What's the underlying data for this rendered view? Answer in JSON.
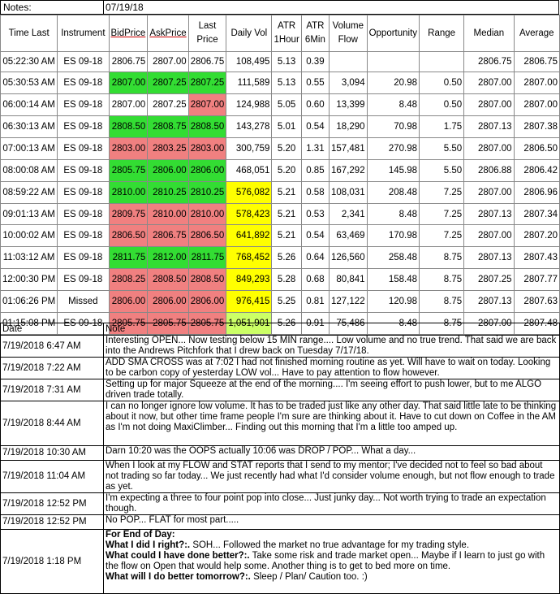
{
  "notes_bar": {
    "label": "Notes:",
    "date": "07/19/18"
  },
  "columns": [
    "Time Last",
    "Instrument",
    "BidPrice",
    "AskPrice",
    "Last Price",
    "Daily Vol",
    "ATR 1Hour",
    "ATR 6Min",
    "Volume Flow",
    "Opportunity",
    "Range",
    "Median",
    "Average"
  ],
  "colors": {
    "red": "#f08080",
    "green": "#33dd33",
    "yellow": "#ffff00",
    "light_green": "#ccff66"
  },
  "rows": [
    {
      "cells": [
        "05:22:30 AM",
        "ES 09-18",
        "2806.75",
        "2807.00",
        "2806.75",
        "108,495",
        "5.13",
        "0.39",
        "",
        "",
        "",
        "2806.75",
        "2806.75"
      ],
      "bid": "",
      "ask": "",
      "last": "",
      "vol": ""
    },
    {
      "cells": [
        "05:30:53 AM",
        "ES 09-18",
        "2807.00",
        "2807.25",
        "2807.25",
        "111,589",
        "5.13",
        "0.55",
        "3,094",
        "20.98",
        "0.50",
        "2807.00",
        "2807.00"
      ],
      "bid": "green",
      "ask": "green",
      "last": "green",
      "vol": ""
    },
    {
      "cells": [
        "06:00:14 AM",
        "ES 09-18",
        "2807.00",
        "2807.25",
        "2807.00",
        "124,988",
        "5.05",
        "0.60",
        "13,399",
        "8.48",
        "0.50",
        "2807.00",
        "2807.00"
      ],
      "bid": "",
      "ask": "",
      "last": "red",
      "vol": ""
    },
    {
      "cells": [
        "06:30:13 AM",
        "ES 09-18",
        "2808.50",
        "2808.75",
        "2808.50",
        "143,278",
        "5.01",
        "0.54",
        "18,290",
        "70.98",
        "1.75",
        "2807.13",
        "2807.38"
      ],
      "bid": "green",
      "ask": "green",
      "last": "green",
      "vol": ""
    },
    {
      "cells": [
        "07:00:13 AM",
        "ES 09-18",
        "2803.00",
        "2803.25",
        "2803.00",
        "300,759",
        "5.20",
        "1.31",
        "157,481",
        "270.98",
        "5.50",
        "2807.00",
        "2806.50"
      ],
      "bid": "red",
      "ask": "red",
      "last": "red",
      "vol": ""
    },
    {
      "cells": [
        "08:00:08 AM",
        "ES 09-18",
        "2805.75",
        "2806.00",
        "2806.00",
        "468,051",
        "5.20",
        "0.85",
        "167,292",
        "145.98",
        "5.50",
        "2806.88",
        "2806.42"
      ],
      "bid": "green",
      "ask": "green",
      "last": "green",
      "vol": ""
    },
    {
      "cells": [
        "08:59:22 AM",
        "ES 09-18",
        "2810.00",
        "2810.25",
        "2810.25",
        "576,082",
        "5.21",
        "0.58",
        "108,031",
        "208.48",
        "7.25",
        "2807.00",
        "2806.96"
      ],
      "bid": "green",
      "ask": "green",
      "last": "green",
      "vol": "yellow"
    },
    {
      "cells": [
        "09:01:13 AM",
        "ES 09-18",
        "2809.75",
        "2810.00",
        "2810.00",
        "578,423",
        "5.21",
        "0.53",
        "2,341",
        "8.48",
        "7.25",
        "2807.13",
        "2807.34"
      ],
      "bid": "red",
      "ask": "red",
      "last": "red",
      "vol": "yellow"
    },
    {
      "cells": [
        "10:00:02 AM",
        "ES 09-18",
        "2806.50",
        "2806.75",
        "2806.50",
        "641,892",
        "5.21",
        "0.54",
        "63,469",
        "170.98",
        "7.25",
        "2807.00",
        "2807.20"
      ],
      "bid": "red",
      "ask": "red",
      "last": "red",
      "vol": "yellow"
    },
    {
      "cells": [
        "11:03:12 AM",
        "ES 09-18",
        "2811.75",
        "2812.00",
        "2811.75",
        "768,452",
        "5.26",
        "0.64",
        "126,560",
        "258.48",
        "8.75",
        "2807.13",
        "2807.43"
      ],
      "bid": "green",
      "ask": "green",
      "last": "green",
      "vol": "yellow"
    },
    {
      "cells": [
        "12:00:30 PM",
        "ES 09-18",
        "2808.25",
        "2808.50",
        "2808.50",
        "849,293",
        "5.28",
        "0.68",
        "80,841",
        "158.48",
        "8.75",
        "2807.25",
        "2807.77"
      ],
      "bid": "red",
      "ask": "red",
      "last": "red",
      "vol": "yellow"
    },
    {
      "cells": [
        "01:06:26 PM",
        "Missed",
        "2806.00",
        "2806.00",
        "2806.00",
        "976,415",
        "5.25",
        "0.81",
        "127,122",
        "120.98",
        "8.75",
        "2807.13",
        "2807.63"
      ],
      "bid": "red",
      "ask": "red",
      "last": "red",
      "vol": "yellow"
    },
    {
      "cells": [
        "01:15:08 PM",
        "ES 09-18",
        "2805.75",
        "2805.75",
        "2805.75",
        "1,051,901",
        "5.26",
        "0.91",
        "75,486",
        "8.48",
        "8.75",
        "2807.00",
        "2807.48"
      ],
      "bid": "red",
      "ask": "red",
      "last": "red",
      "vol": "light_green"
    }
  ],
  "notes_header": {
    "date": "Date",
    "note": "Note"
  },
  "notes": [
    {
      "date": "7/19/2018 6:47 AM",
      "text": "Interesting OPEN... Now testing below 15 MIN range.... Low volume and no true trend.  That said we are back into the Andrews Pitchfork that I drew back on Tuesday 7/17/18."
    },
    {
      "date": "7/19/2018 7:22 AM",
      "text": "ADD SMA CROSS was at 7:02 I had not finished morning routine as yet.  Will have to wait on today.  Looking to be carbon copy of yesterday LOW vol... Have to pay attention to flow however."
    },
    {
      "date": "7/19/2018 7:31 AM",
      "text": "Setting up for major Squeeze at the end of the morning.... I'm seeing effort to push lower, but to me ALGO driven trade totally."
    },
    {
      "date": "7/19/2018 8:44 AM",
      "text": "I can no longer ignore low volume.  It has to be traded just like any other day.  That said little late to be thinking about it now, but other time frame people I'm sure are thinking about it.  Have to cut down on Coffee in the AM as I'm not doing MaxiClimber... Finding out this morning that I'm a little too amped up."
    },
    {
      "date": "7/19/2018 10:30 AM",
      "text": "Darn 10:20 was the OOPS actually 10:06 was DROP / POP... What a day..."
    },
    {
      "date": "7/19/2018 11:04 AM",
      "text": "When I look at my FLOW and STAT reports that I send to my mentor; I've decided not to feel so bad about not trading so far today... We just recently had what I'd consider volume enough, but not flow enough to trade as yet."
    },
    {
      "date": "7/19/2018 12:52 PM",
      "text": "I'm expecting a three to  four point pop into close... Just junky day... Not worth trying to trade an expectation though."
    },
    {
      "date": "7/19/2018 12:52 PM",
      "text": "No POP... FLAT for most part....."
    }
  ],
  "final_note": {
    "date": "7/19/2018 1:18 PM",
    "heading": "For End of Day:",
    "q1": "What I did I right?:.",
    "a1": "  SOH... Followed the market no true advantage for my trading style.",
    "q2": "What could I have done better?:.",
    "a2": "  Take some risk and trade market open... Maybe if I learn to just go with the flow on Open that would help some.  Another thing is to get to bed more on time.",
    "q3": "What will I do better tomorrow?:.",
    "a3": "  Sleep / Plan/ Caution too. :)"
  }
}
